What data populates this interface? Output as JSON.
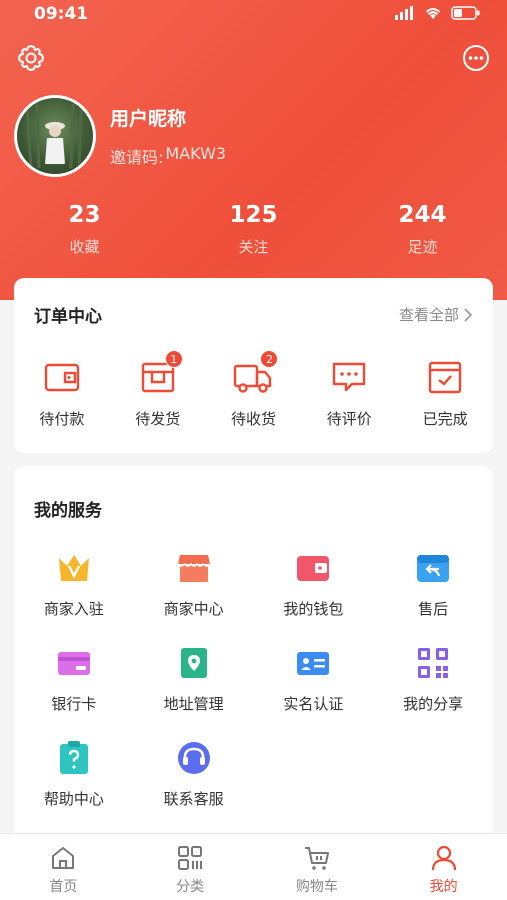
{
  "status_bar": {
    "time": "09:41"
  },
  "profile": {
    "nickname": "用户昵称",
    "invite_label": "邀请码:",
    "invite_code": "MAKW3"
  },
  "stats": [
    {
      "value": "23",
      "label": "收藏"
    },
    {
      "value": "125",
      "label": "关注"
    },
    {
      "value": "244",
      "label": "足迹"
    }
  ],
  "orders": {
    "title": "订单中心",
    "view_all": "查看全部",
    "items": [
      {
        "label": "待付款",
        "icon": "wallet-icon",
        "badge": ""
      },
      {
        "label": "待发货",
        "icon": "package-icon",
        "badge": "1"
      },
      {
        "label": "待收货",
        "icon": "truck-icon",
        "badge": "2"
      },
      {
        "label": "待评价",
        "icon": "comment-icon",
        "badge": ""
      },
      {
        "label": "已完成",
        "icon": "calendar-check-icon",
        "badge": ""
      }
    ]
  },
  "services": {
    "title": "我的服务",
    "items": [
      {
        "label": "商家入驻",
        "icon": "crown-icon"
      },
      {
        "label": "商家中心",
        "icon": "store-icon"
      },
      {
        "label": "我的钱包",
        "icon": "wallet-icon"
      },
      {
        "label": "售后",
        "icon": "return-icon"
      },
      {
        "label": "银行卡",
        "icon": "card-icon"
      },
      {
        "label": "地址管理",
        "icon": "location-icon"
      },
      {
        "label": "实名认证",
        "icon": "id-card-icon"
      },
      {
        "label": "我的分享",
        "icon": "qr-code-icon"
      },
      {
        "label": "帮助中心",
        "icon": "help-icon"
      },
      {
        "label": "联系客服",
        "icon": "headset-icon"
      }
    ]
  },
  "tabbar": [
    {
      "label": "首页",
      "icon": "home-icon",
      "active": false
    },
    {
      "label": "分类",
      "icon": "grid-icon",
      "active": false
    },
    {
      "label": "购物车",
      "icon": "cart-icon",
      "active": false
    },
    {
      "label": "我的",
      "icon": "user-icon",
      "active": true
    }
  ],
  "colors": {
    "accent": "#ee4a35"
  }
}
